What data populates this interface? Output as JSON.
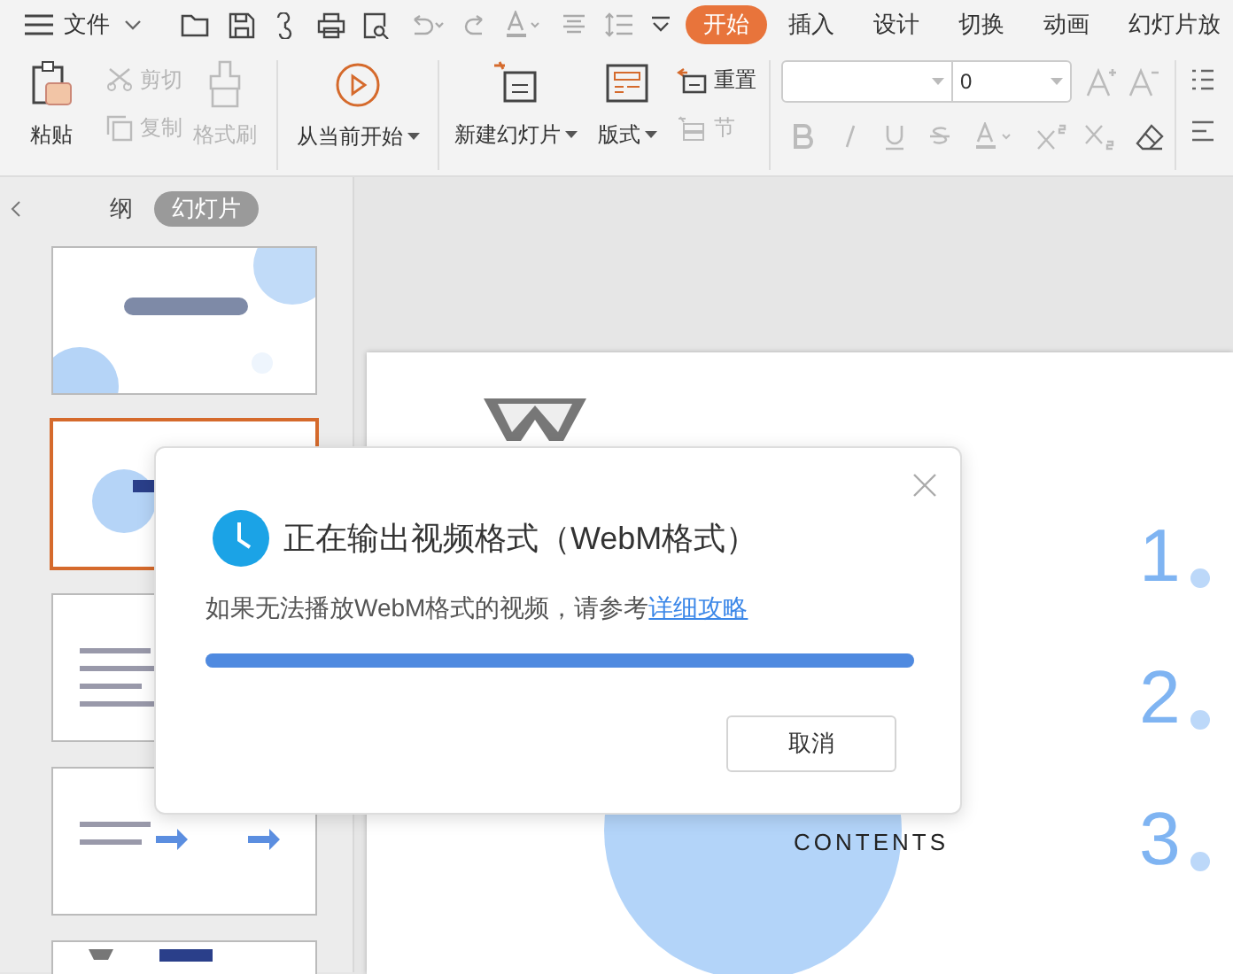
{
  "menu": {
    "label": "文件"
  },
  "tabs": [
    {
      "label": "开始",
      "selected": true
    },
    {
      "label": "插入",
      "selected": false
    },
    {
      "label": "设计",
      "selected": false
    },
    {
      "label": "切换",
      "selected": false
    },
    {
      "label": "动画",
      "selected": false
    },
    {
      "label": "幻灯片放",
      "selected": false
    }
  ],
  "ribbon": {
    "paste": {
      "label": "粘贴"
    },
    "small": [
      {
        "label": "剪切",
        "disabled": true
      },
      {
        "label": "复制",
        "disabled": true
      }
    ],
    "format_painter": {
      "label": "格式刷",
      "disabled": true
    },
    "play": {
      "label": "从当前开始"
    },
    "new_slide": {
      "label": "新建幻灯片"
    },
    "layout": {
      "label": "版式"
    },
    "slide_tools": [
      {
        "label": "重置",
        "disabled": false
      },
      {
        "label": "节",
        "disabled": true
      }
    ],
    "font_size": {
      "value": "0"
    }
  },
  "panel": {
    "tabs": [
      {
        "label": "纲",
        "selected": false
      },
      {
        "label": "幻灯片",
        "selected": true
      }
    ],
    "thumbnails": [
      {
        "selected": false
      },
      {
        "selected": true
      },
      {
        "selected": false
      },
      {
        "selected": false
      },
      {
        "selected": false
      }
    ]
  },
  "slide": {
    "heading": "CONTENTS",
    "numbers": [
      "1",
      "2",
      "3"
    ]
  },
  "dialog": {
    "title": "正在输出视频格式（WebM格式）",
    "message": "如果无法播放WebM格式的视频，请参考",
    "link": "详细攻略",
    "progress": {
      "level": 1
    },
    "cancel": "取消"
  }
}
